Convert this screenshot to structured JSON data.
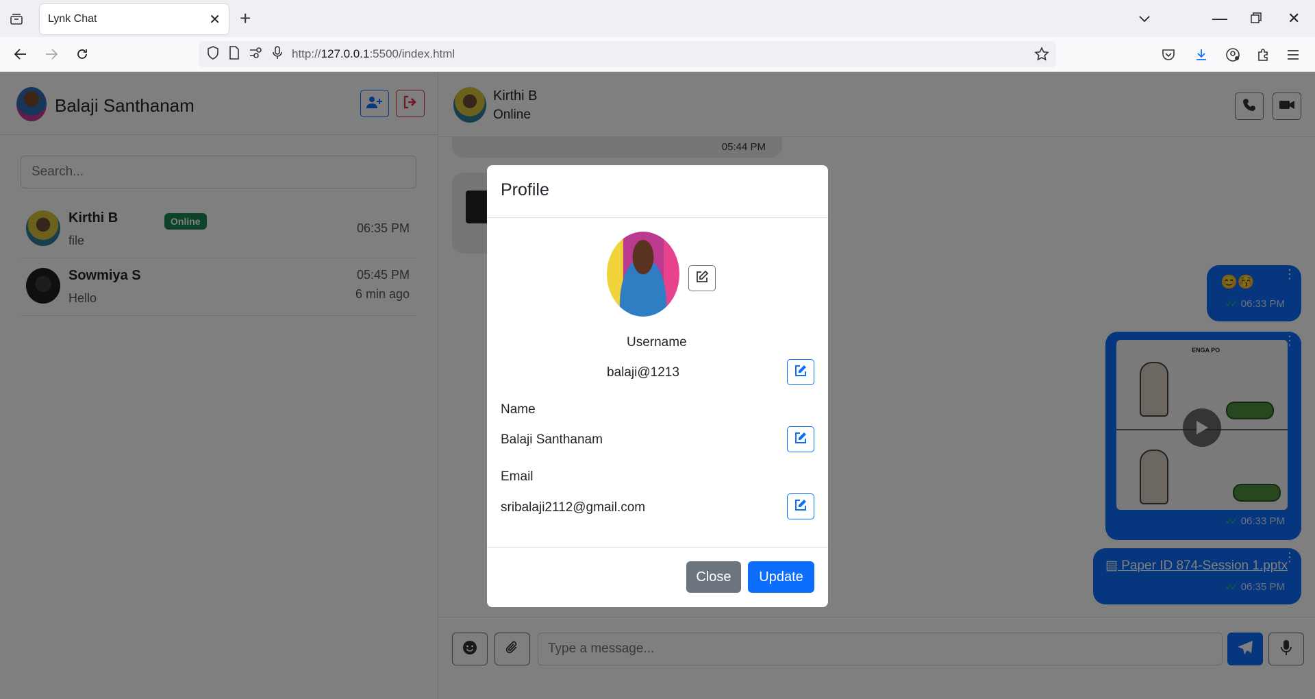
{
  "browser": {
    "tab_title": "Lynk Chat",
    "url_prefix": "http://",
    "url_host": "127.0.0.1",
    "url_rest": ":5500/index.html"
  },
  "sidebar": {
    "user_name": "Balaji Santhanam",
    "search_placeholder": "Search...",
    "contacts": [
      {
        "name": "Kirthi B",
        "last_message": "file",
        "time": "06:35 PM",
        "badge": "Online"
      },
      {
        "name": "Sowmiya S",
        "last_message": "Hello",
        "time": "05:45 PM",
        "ago": "6 min ago"
      }
    ]
  },
  "chat": {
    "peer_name": "Kirthi B",
    "peer_status": "Online",
    "messages": {
      "incoming_time": "05:44 PM",
      "emoji_msg": "😊😚",
      "emoji_time": "06:33 PM",
      "video_caption": "ENGA PO",
      "video_time": "06:33 PM",
      "file_name": "Paper ID 874-Session 1.pptx",
      "file_time": "06:35 PM"
    },
    "input_placeholder": "Type a message..."
  },
  "modal": {
    "title": "Profile",
    "username_label": "Username",
    "username_value": "balaji@1213",
    "name_label": "Name",
    "name_value": "Balaji Santhanam",
    "email_label": "Email",
    "email_value": "sribalaji2112@gmail.com",
    "close_label": "Close",
    "update_label": "Update"
  },
  "colors": {
    "primary": "#0d6efd",
    "success": "#198754",
    "danger": "#dc3545",
    "secondary": "#6c757d"
  }
}
